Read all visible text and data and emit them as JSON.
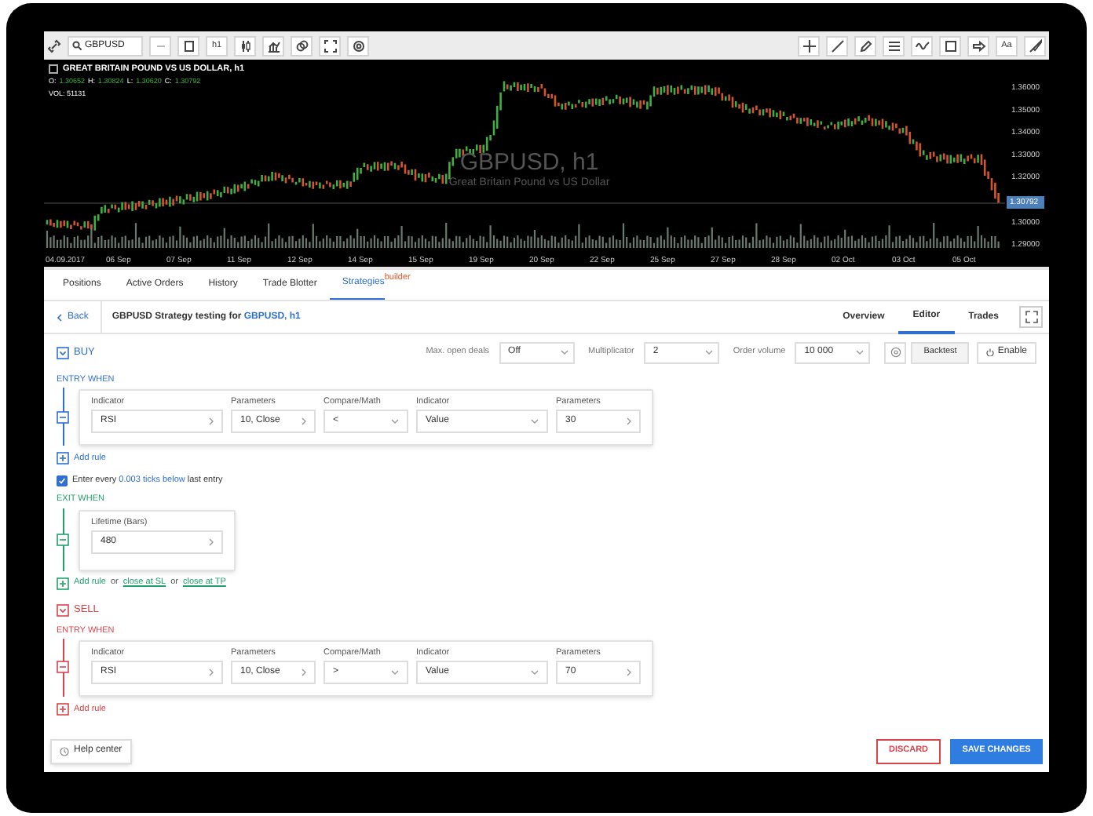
{
  "toolbar": {
    "symbol": "GBPUSD",
    "timeframe": "h1",
    "text_tool": "Aa"
  },
  "chart": {
    "title": "GREAT BRITAIN POUND VS US DOLLAR, h1",
    "ohlc": [
      {
        "label": "O:",
        "value": "1.30652"
      },
      {
        "label": "H:",
        "value": "1.30824"
      },
      {
        "label": "L:",
        "value": "1.30620"
      },
      {
        "label": "C:",
        "value": "1.30792"
      }
    ],
    "volume": "VOL: 51131",
    "caption": "GBPUSD, h1",
    "subcaption": "Great Britain Pound vs US Dollar",
    "price_labels_upper": [
      "1.36000",
      "1.35000",
      "1.34000",
      "1.33000",
      "1.32000"
    ],
    "price_labels_lower": [
      "1.30000",
      "1.29000"
    ],
    "current_price": "1.30792",
    "date_labels": [
      "04.09.2017",
      "06 Sep",
      "07 Sep",
      "11 Sep",
      "12 Sep",
      "14 Sep",
      "15 Sep",
      "19 Sep",
      "20 Sep",
      "22 Sep",
      "25 Sep",
      "27 Sep",
      "28 Sep",
      "02 Oct",
      "03 Oct",
      "05 Oct"
    ]
  },
  "tabs": [
    {
      "label": "Positions",
      "selected": false
    },
    {
      "label": "Active Orders",
      "selected": false
    },
    {
      "label": "History",
      "selected": false
    },
    {
      "label": "Trade Blotter",
      "selected": false
    },
    {
      "label": "Strategies",
      "selected": true,
      "badge": "builder"
    }
  ],
  "header": {
    "back": "Back",
    "title": "GBPUSD Strategy testing for",
    "title_link": "GBPUSD, h1",
    "views": [
      {
        "label": "Overview",
        "selected": false
      },
      {
        "label": "Editor",
        "selected": true
      },
      {
        "label": "Trades",
        "selected": false
      }
    ]
  },
  "settings": [
    {
      "label": "Max. open deals",
      "value": "Off"
    },
    {
      "label": "Multiplicator",
      "value": "2"
    },
    {
      "label": "Order volume",
      "value": "10 000"
    }
  ],
  "actions": [
    {
      "kind": "backtest",
      "label": "Backtest"
    },
    {
      "kind": "enable",
      "label": "Enable"
    }
  ],
  "sections": [
    {
      "kind": "buy",
      "label": "BUY",
      "groups": [
        {
          "kind": "entry",
          "title": "ENTRY WHEN",
          "rules": [
            {
              "fields": [
                {
                  "label": "Indicator",
                  "value": "RSI",
                  "kind": "picker"
                },
                {
                  "label": "Parameters",
                  "value": "10, Close",
                  "kind": "picker"
                },
                {
                  "label": "Compare/Math",
                  "value": "<",
                  "kind": "select"
                },
                {
                  "label": "Indicator",
                  "value": "Value",
                  "kind": "select"
                },
                {
                  "label": "Parameters",
                  "value": "30",
                  "kind": "picker"
                }
              ]
            }
          ],
          "footer": [
            {
              "kind": "action",
              "text": "Add rule"
            }
          ],
          "option": {
            "checked": true,
            "prefix": "Enter every",
            "link": "0.003 ticks below",
            "suffix": "last entry"
          }
        },
        {
          "kind": "exit",
          "title": "EXIT WHEN",
          "rules": [
            {
              "fields": [
                {
                  "label": "Lifetime (Bars)",
                  "value": "480",
                  "kind": "picker"
                }
              ]
            }
          ],
          "footer": [
            {
              "kind": "action",
              "text": "Add rule"
            },
            {
              "kind": "text",
              "text": "or"
            },
            {
              "kind": "link",
              "text": "close at SL"
            },
            {
              "kind": "text",
              "text": "or"
            },
            {
              "kind": "link",
              "text": "close at TP"
            }
          ]
        }
      ]
    },
    {
      "kind": "sell",
      "label": "SELL",
      "groups": [
        {
          "kind": "entry",
          "title": "ENTRY WHEN",
          "rules": [
            {
              "fields": [
                {
                  "label": "Indicator",
                  "value": "RSI",
                  "kind": "picker"
                },
                {
                  "label": "Parameters",
                  "value": "10, Close",
                  "kind": "picker"
                },
                {
                  "label": "Compare/Math",
                  "value": ">",
                  "kind": "select"
                },
                {
                  "label": "Indicator",
                  "value": "Value",
                  "kind": "select"
                },
                {
                  "label": "Parameters",
                  "value": "70",
                  "kind": "picker"
                }
              ]
            }
          ],
          "footer": [
            {
              "kind": "action",
              "text": "Add rule"
            }
          ]
        }
      ]
    }
  ],
  "footer": {
    "help": "Help center",
    "discard": "DISCARD",
    "save": "SAVE CHANGES"
  }
}
